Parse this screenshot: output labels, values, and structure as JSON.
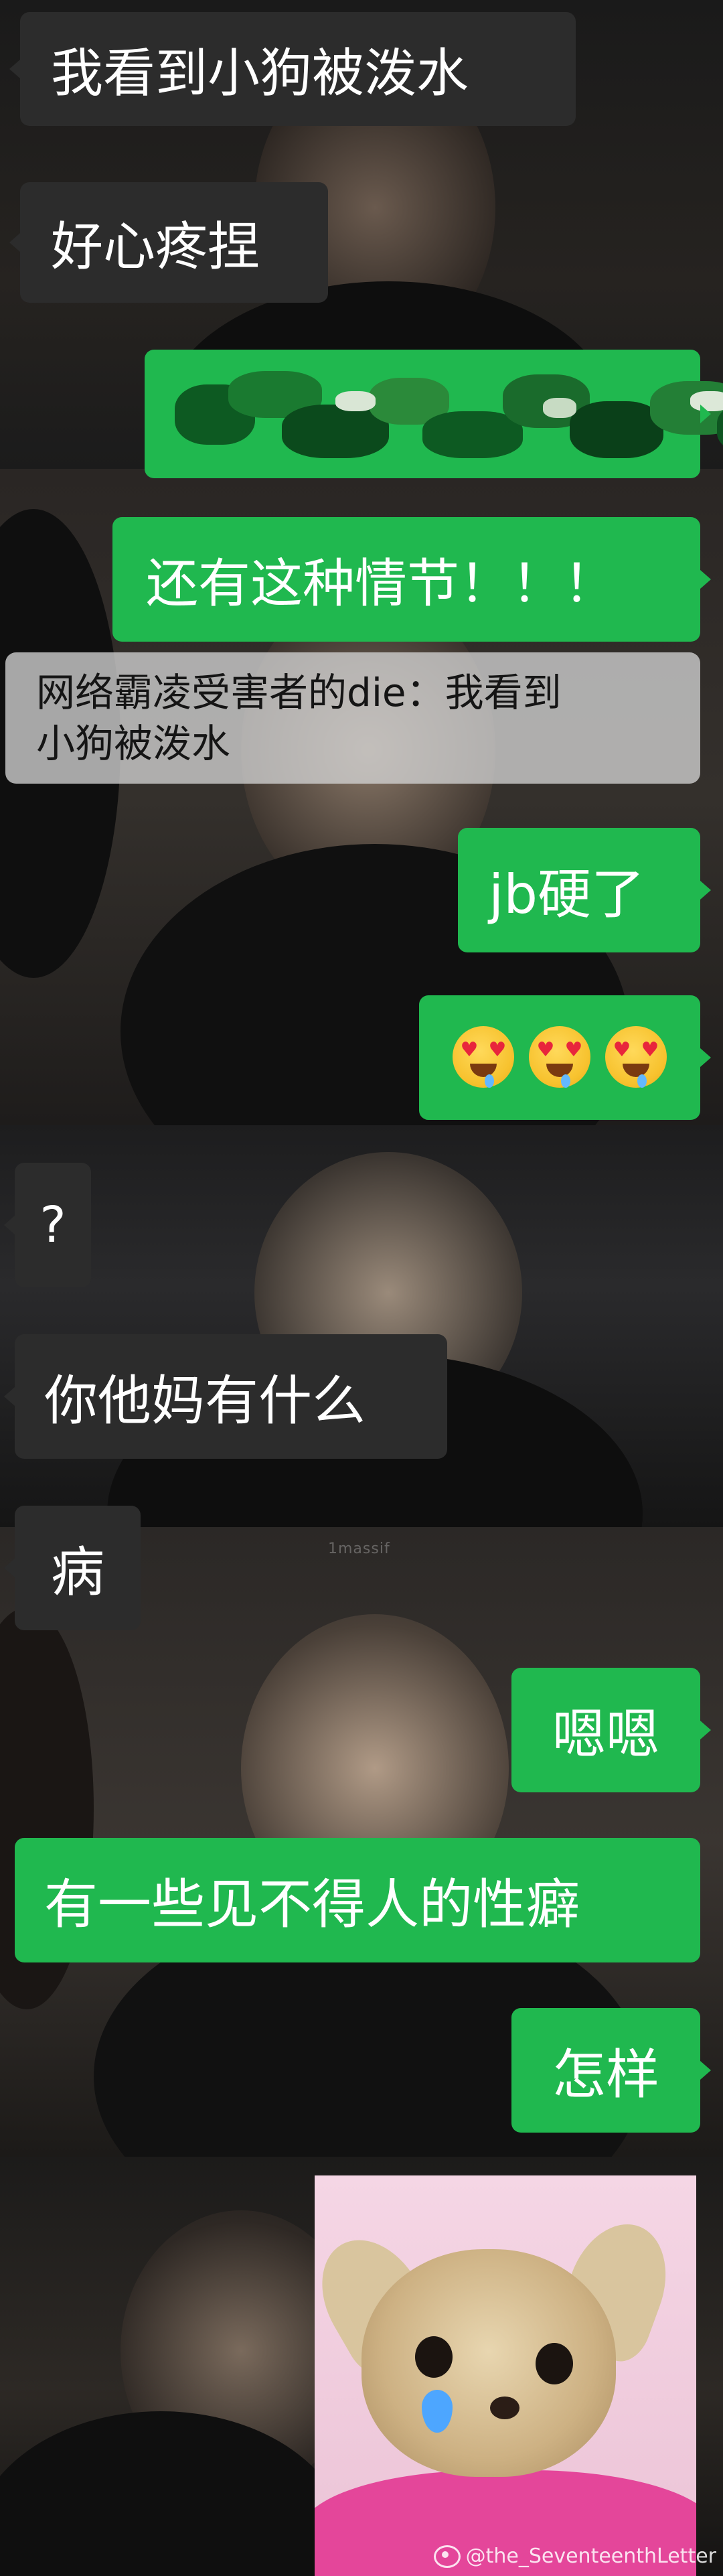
{
  "messages": {
    "m1": "我看到小狗被泼水",
    "m2": "好心疼捏",
    "m4": "还有这种情节！！！",
    "m5_line1": "网络霸凌受害者的die：我看到",
    "m5_line2": "小狗被泼水",
    "m6": "jb硬了",
    "m7_emoji": "😍😍😍",
    "m8": "?",
    "m9": "你他妈有什么",
    "m10": "病",
    "m11": "嗯嗯",
    "m12": "有一些见不得人的性癖",
    "m13": "怎样"
  },
  "watermarks": {
    "background": "1massif",
    "footer": "@the_SeventeenthLetter"
  },
  "colors": {
    "green_bubble": "#20b84f",
    "dark_bubble": "#2c2c2c",
    "grey_bubble": "#d2d2d2"
  },
  "icons": {
    "footer_logo": "weibo-icon",
    "tear": "tear-drop-icon"
  }
}
